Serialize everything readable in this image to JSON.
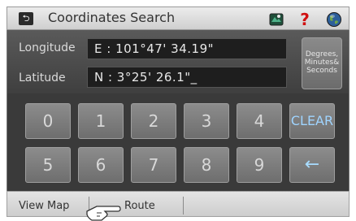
{
  "title": "Coordinates Search",
  "icons": {
    "back": "back-icon",
    "map": "map-icon",
    "help": "help-icon",
    "globe": "globe-icon",
    "hand": "hand-pointer-icon"
  },
  "help_symbol": "?",
  "back_symbol": "⮌",
  "longitude": {
    "label": "Longitude",
    "value": "E : 101°47' 34.19\""
  },
  "latitude": {
    "label": "Latitude",
    "value": "N : 3°25' 26.1\"_"
  },
  "format_button": {
    "line1": "Degrees,",
    "line2": "Minutes&",
    "line3": "Seconds"
  },
  "keypad": {
    "row1": [
      "0",
      "1",
      "2",
      "3",
      "4"
    ],
    "row2": [
      "5",
      "6",
      "7",
      "8",
      "9"
    ],
    "clear_label": "CLEAR",
    "backspace_label": "←"
  },
  "bottom": {
    "view_map": "View Map",
    "route": "Route"
  },
  "colors": {
    "accent_blue": "#9fd4ff",
    "help_red": "#d01010",
    "dark_panel": "#3a3a3a"
  }
}
